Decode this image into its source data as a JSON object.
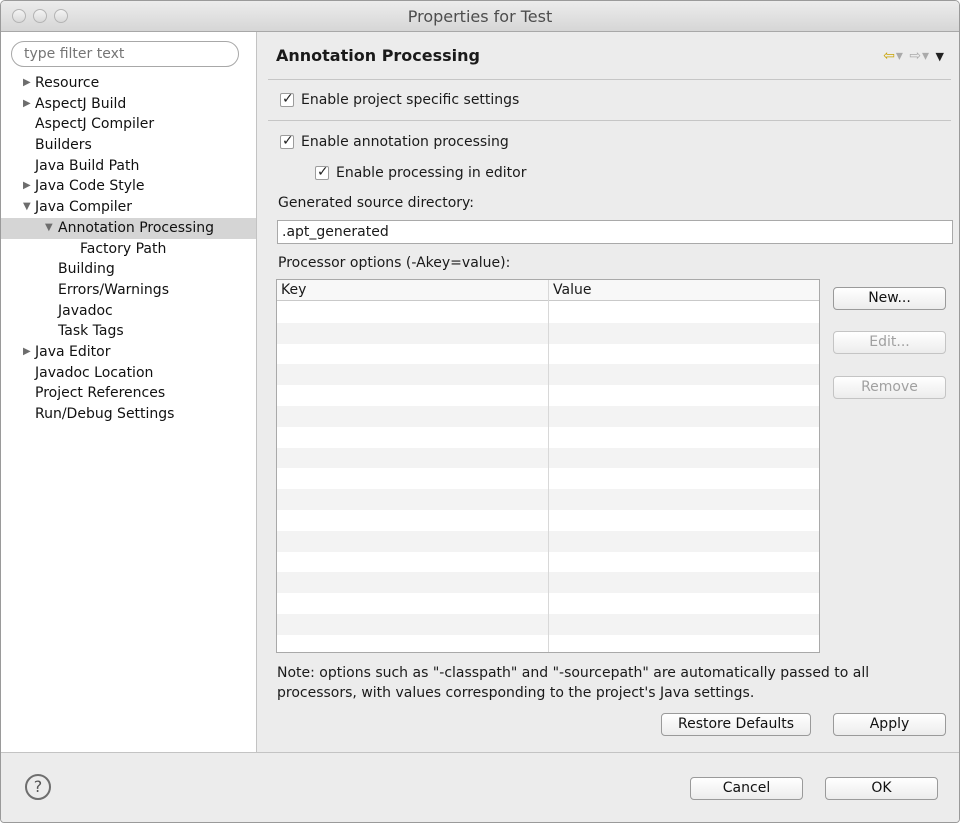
{
  "window": {
    "title": "Properties for Test"
  },
  "filter": {
    "placeholder": "type filter text"
  },
  "tree": {
    "resource": "Resource",
    "aspectj_build": "AspectJ Build",
    "aspectj_compiler": "AspectJ Compiler",
    "builders": "Builders",
    "java_build_path": "Java Build Path",
    "java_code_style": "Java Code Style",
    "java_compiler": "Java Compiler",
    "annotation_processing": "Annotation Processing",
    "factory_path": "Factory Path",
    "building": "Building",
    "errors_warnings": "Errors/Warnings",
    "javadoc": "Javadoc",
    "task_tags": "Task Tags",
    "java_editor": "Java Editor",
    "javadoc_location": "Javadoc Location",
    "project_references": "Project References",
    "run_debug_settings": "Run/Debug Settings"
  },
  "page": {
    "title": "Annotation Processing",
    "enable_project_specific": "Enable project specific settings",
    "enable_annotation_processing": "Enable annotation processing",
    "enable_processing_in_editor": "Enable processing in editor",
    "generated_source_label": "Generated source directory:",
    "generated_source_value": ".apt_generated",
    "processor_options_label": "Processor options (-Akey=value):",
    "table_headers": {
      "key": "Key",
      "value": "Value"
    },
    "note": "Note: options such as \"-classpath\" and \"-sourcepath\" are automatically passed to all processors, with values corresponding to the project's Java settings."
  },
  "buttons": {
    "new": "New...",
    "edit": "Edit...",
    "remove": "Remove",
    "restore_defaults": "Restore Defaults",
    "apply": "Apply",
    "cancel": "Cancel",
    "ok": "OK",
    "help": "?"
  },
  "icons": {
    "back": "back-arrow-icon",
    "forward": "forward-arrow-icon",
    "menu": "view-menu-icon"
  },
  "colors": {
    "selection": "#d5d5d5",
    "back_arrow": "#c8a200"
  }
}
